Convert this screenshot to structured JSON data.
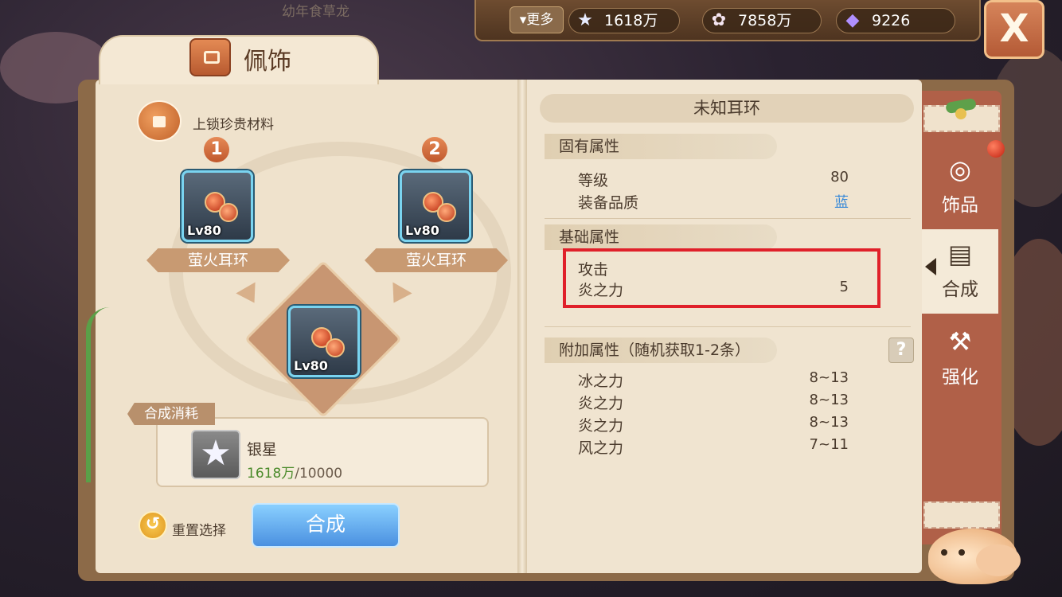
{
  "background": {
    "top_text": "幼年食草龙"
  },
  "topbar": {
    "more_label": "更多",
    "currencies": [
      {
        "icon": "star-icon",
        "value": "1618万"
      },
      {
        "icon": "shell-icon",
        "value": "7858万"
      },
      {
        "icon": "crystal-icon",
        "value": "9226"
      }
    ],
    "close_label": "X"
  },
  "page_title": "佩饰",
  "left": {
    "lock_label": "上锁珍贵材料",
    "slot1": {
      "badge": "1",
      "level": "Lv80",
      "name": "萤火耳环"
    },
    "slot2": {
      "badge": "2",
      "level": "Lv80",
      "name": "萤火耳环"
    },
    "result": {
      "level": "Lv80"
    },
    "cost": {
      "label": "合成消耗",
      "item_name": "银星",
      "have": "1618万",
      "need": "/10000"
    },
    "reset_label": "重置选择",
    "compose_button": "合成"
  },
  "right": {
    "item_title": "未知耳环",
    "inherent": {
      "title": "固有属性",
      "rows": [
        {
          "label": "等级",
          "value": "80"
        },
        {
          "label": "装备品质",
          "value": "蓝",
          "color": "#3a8ad8"
        }
      ]
    },
    "base": {
      "title": "基础属性",
      "rows": [
        {
          "label": "攻击",
          "value": ""
        },
        {
          "label": "炎之力",
          "value": "5"
        }
      ]
    },
    "extra": {
      "title": "附加属性（随机获取1-2条）",
      "help": "?",
      "rows": [
        {
          "label": "冰之力",
          "value": "8~13"
        },
        {
          "label": "炎之力",
          "value": "8~13"
        },
        {
          "label": "炎之力",
          "value": "8~13"
        },
        {
          "label": "风之力",
          "value": "7~11"
        }
      ]
    }
  },
  "side_tabs": [
    {
      "label": "饰品",
      "icon": "ring-icon",
      "glyph": "◎",
      "active": false
    },
    {
      "label": "合成",
      "icon": "scroll-icon",
      "glyph": "▤",
      "active": true
    },
    {
      "label": "强化",
      "icon": "hammer-icon",
      "glyph": "⚒",
      "active": false
    }
  ]
}
